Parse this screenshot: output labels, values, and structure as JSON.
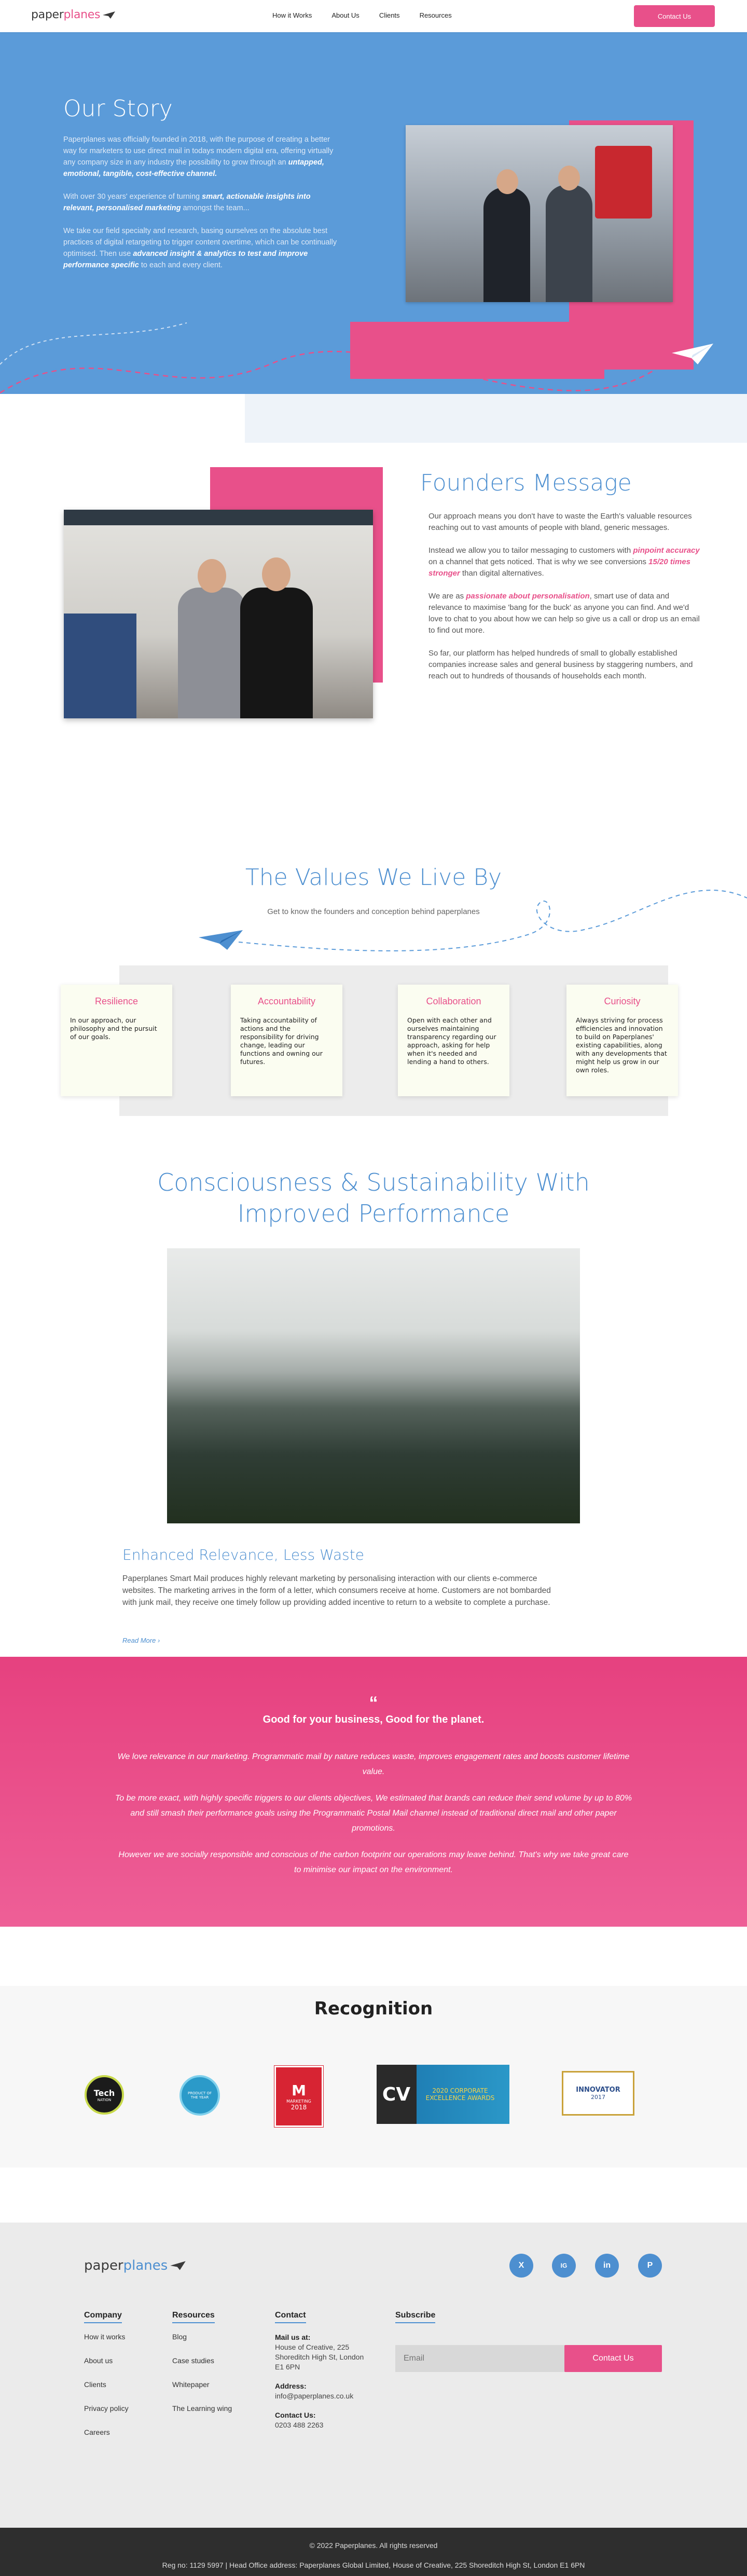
{
  "header": {
    "logo_part1": "paper",
    "logo_part2": "planes",
    "nav": [
      "How it Works",
      "About Us",
      "Clients",
      "Resources"
    ],
    "cta": "Contact Us"
  },
  "story": {
    "title": "Our Story",
    "p1": "Paperplanes was officially founded in 2018, with the purpose of creating a better way for marketers to use direct mail in todays modern digital era, offering virtually any company size in any industry the possibility to grow through an ",
    "p1_bold": "untapped, emotional, tangible, cost-effective channel.",
    "p2": "With over 30 years' experience of turning ",
    "p2_bold": "smart, actionable insights into relevant, personalised marketing",
    "p2_end": " amongst the team...",
    "p3": "We take our field specialty and research, basing ourselves on the absolute best practices of digital retargeting to trigger content overtime, which can be continually optimised. Then use ",
    "p3_bold": "advanced insight & analytics to test and improve performance specific",
    "p3_end": " to each and every client."
  },
  "founders": {
    "title": "Founders Message",
    "p1": "Our approach means you don't have to waste the Earth's valuable resources reaching out to vast amounts of people with bland, generic messages.",
    "p2a": "Instead we allow you to tailor messaging to customers with ",
    "p2b": "pinpoint accuracy",
    "p2c": " on a channel that gets noticed. That is why we see conversions ",
    "p2d": "15/20 times stronger",
    "p2e": " than digital alternatives.",
    "p3a": "We are as ",
    "p3b": "passionate about personalisation",
    "p3c": ", smart use of data and relevance to maximise 'bang for the buck' as anyone you can find. And we'd love to chat to you about how we can help so give us a call or drop us an email to find out more.",
    "p4": "So far, our platform has helped hundreds of small to globally established companies increase sales and general business by staggering numbers, and reach out to hundreds of thousands of households each month."
  },
  "values": {
    "title": "The Values We Live By",
    "subtitle": "Get to know the founders and conception behind paperplanes",
    "cards": [
      {
        "title": "Resilience",
        "text": "In our approach, our philosophy and the pursuit of our goals."
      },
      {
        "title": "Accountability",
        "text": "Taking accountability of actions and the responsibility for driving change, leading our functions and owning our futures."
      },
      {
        "title": "Collaboration",
        "text": "Open with each other and ourselves maintaining transparency regarding our approach, asking for help when it's needed and lending a hand to others."
      },
      {
        "title": "Curiosity",
        "text": "Always striving for process efficiencies and innovation to build on Paperplanes' existing capabilities, along with any developments that might help us grow in our own roles."
      }
    ]
  },
  "consciousness": {
    "title_line1": "Consciousness & Sustainability With",
    "title_line2": "Improved Performance",
    "sub_title": "Enhanced Relevance, Less Waste",
    "text": "Paperplanes Smart Mail produces highly relevant marketing by personalising interaction with our clients e-commerce websites. The marketing arrives in the form of a letter, which consumers receive at home. Customers are not bombarded with junk mail, they receive one timely follow up providing added incentive to return to a website to complete a purchase.",
    "read_more": "Read More"
  },
  "pink_band": {
    "quote": "“",
    "heading": "Good for your business, Good for the planet.",
    "p1": "We love relevance in our marketing. Programmatic mail by nature reduces waste, improves engagement rates and boosts customer lifetime value.",
    "p2": "To be more exact, with highly specific triggers to our clients objectives, We estimated that brands can reduce their send volume by up to 80% and still smash their performance goals using the Programmatic Postal Mail channel instead of traditional direct mail and other paper promotions.",
    "p3": "However we are socially responsible and conscious of the carbon footprint our operations may leave behind. That's why we take great care to minimise our impact on the environment."
  },
  "recognition": {
    "title": "Recognition",
    "badges": [
      {
        "label": "Tech",
        "sub": "NATION"
      },
      {
        "label": "PRODUCT OF THE YEAR",
        "sub": ""
      },
      {
        "label": "MARKETING",
        "sub": "2018"
      },
      {
        "label": "CV",
        "sub": "2020 CORPORATE EXCELLENCE AWARDS"
      },
      {
        "label": "INNOVATOR",
        "sub": "2017"
      }
    ]
  },
  "footer": {
    "logo_part1": "paper",
    "logo_part2": "planes",
    "social": [
      "X",
      "IG",
      "in",
      "P"
    ],
    "company": {
      "heading": "Company",
      "links": [
        "How it works",
        "About us",
        "Clients",
        "Privacy policy",
        "Careers"
      ]
    },
    "resources": {
      "heading": "Resources",
      "links": [
        "Blog",
        "Case studies",
        "Whitepaper",
        "The Learning wing"
      ]
    },
    "contact": {
      "heading": "Contact",
      "mail_label": "Mail us at:",
      "mail": "House of Creative, 225 Shoreditch High St, London E1 6PN",
      "address_label": "Address:",
      "address": "info@paperplanes.co.uk",
      "phone_label": "Contact Us:",
      "phone": "0203 488 2263"
    },
    "subscribe": {
      "heading": "Subscribe",
      "placeholder": "Email",
      "button": "Contact Us"
    },
    "copyright": "© 2022 Paperplanes. All rights reserved",
    "reg": "Reg no: 1129 5997 | Head Office address: Paperplanes Global Limited, House of Creative, 225 Shoreditch High St, London E1 6PN"
  },
  "colors": {
    "brand_blue": "#5b9bd9",
    "brand_pink": "#e8508a",
    "heading_blue": "#4d8fd0"
  }
}
